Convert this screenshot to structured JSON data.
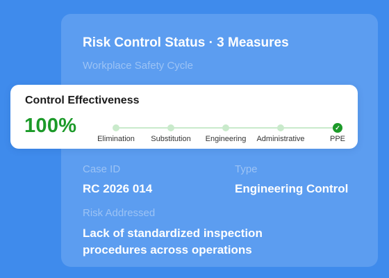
{
  "card": {
    "title": "Risk Control Status · 3 Measures",
    "subtitle": "Workplace Safety Cycle"
  },
  "popup": {
    "heading": "Control Effectiveness",
    "value": "100%",
    "steps": [
      {
        "label": "Elimination",
        "state": "done"
      },
      {
        "label": "Substitution",
        "state": "done"
      },
      {
        "label": "Engineering",
        "state": "done"
      },
      {
        "label": "Administrative",
        "state": "done"
      },
      {
        "label": "PPE",
        "state": "current",
        "icon": "check-icon"
      }
    ]
  },
  "details": {
    "case_id_label": "Case ID",
    "case_id_value": "RC 2026 014",
    "type_label": "Type",
    "type_value": "Engineering Control",
    "risk_label": "Risk Addressed",
    "risk_value": "Lack of standardized inspection procedures across operations"
  },
  "colors": {
    "background": "#3f8bec",
    "card": "#5c9df0",
    "accent_green": "#1c9a29",
    "step_inactive": "#c9eacb",
    "muted_text": "#9cc3f5"
  }
}
